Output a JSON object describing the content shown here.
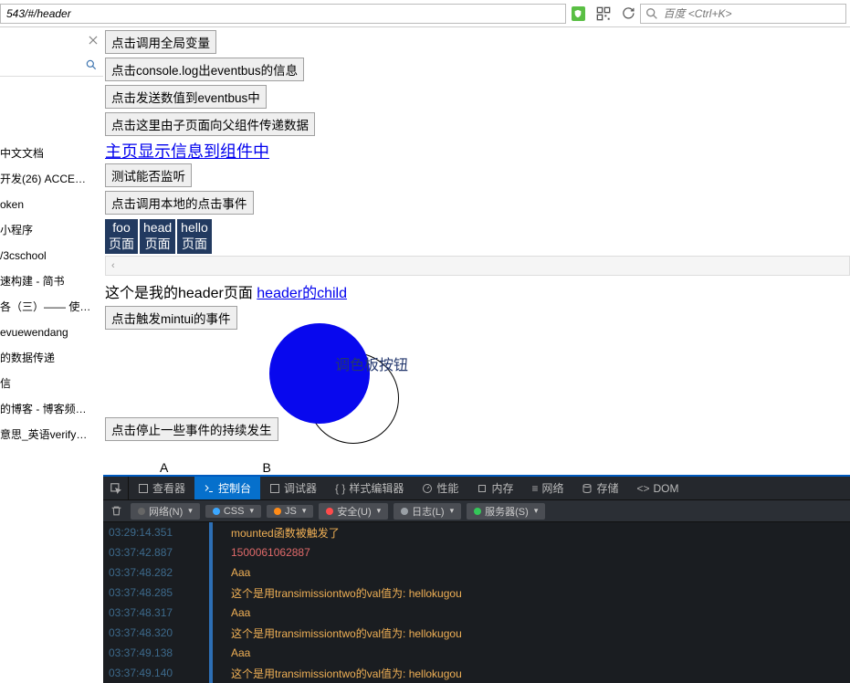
{
  "browser": {
    "url": "543/#/header",
    "search_placeholder": "百度 <Ctrl+K>"
  },
  "sidebar": {
    "links": [
      "中文文档",
      "开发(26) ACCE…",
      "oken",
      "小程序",
      "/3cschool",
      "速构建 - 简书",
      "各（三）—— 使…",
      "evuewendang",
      "的数据传递",
      "信",
      "的博客 - 博客频…",
      "意思_英语verify…",
      ""
    ]
  },
  "content": {
    "buttons": {
      "b1": "点击调用全局变量",
      "b2": "点击console.log出eventbus的信息",
      "b3": "点击发送数值到eventbus中",
      "b4": "点击这里由子页面向父组件传递数据",
      "b5": "测试能否监听",
      "b6": "点击调用本地的点击事件",
      "b7": "点击触发mintui的事件",
      "b8": "点击停止一些事件的持续发生"
    },
    "main_link": "主页显示信息到组件中",
    "navs": [
      {
        "top": "foo",
        "bottom": "页面"
      },
      {
        "top": "head",
        "bottom": "页面"
      },
      {
        "top": "hello",
        "bottom": "页面"
      }
    ],
    "chevron": "‹",
    "header_text": "这个是我的header页面 ",
    "header_child": "header的child",
    "circle_label": "调色板按钮",
    "ab": "A B"
  },
  "devtools": {
    "tabs": {
      "inspector": "查看器",
      "console": "控制台",
      "debugger": "调试器",
      "style": "样式编辑器",
      "perf": "性能",
      "memory": "内存",
      "network": "网络",
      "storage": "存储",
      "dom": "DOM"
    },
    "filters": {
      "net": "网络(N)",
      "css": "CSS",
      "js": "JS",
      "sec": "安全(U)",
      "log": "日志(L)",
      "server": "服务器(S)"
    },
    "logs": [
      {
        "ts": "03:29:14.351",
        "msg": "mounted函数被触发了",
        "cls": ""
      },
      {
        "ts": "03:37:42.887",
        "msg": "1500061062887",
        "cls": "red"
      },
      {
        "ts": "03:37:48.282",
        "msg": "Aaa",
        "cls": ""
      },
      {
        "ts": "03:37:48.285",
        "msg": "这个是用transimissiontwo的val值为: hellokugou",
        "cls": ""
      },
      {
        "ts": "03:37:48.317",
        "msg": "Aaa",
        "cls": ""
      },
      {
        "ts": "03:37:48.320",
        "msg": "这个是用transimissiontwo的val值为: hellokugou",
        "cls": ""
      },
      {
        "ts": "03:37:49.138",
        "msg": "Aaa",
        "cls": ""
      },
      {
        "ts": "03:37:49.140",
        "msg": "这个是用transimissiontwo的val值为: hellokugou",
        "cls": ""
      }
    ]
  }
}
